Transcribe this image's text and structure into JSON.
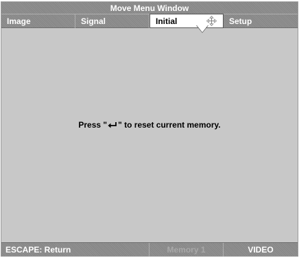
{
  "window": {
    "title": "Move Menu Window"
  },
  "tabs": [
    {
      "label": "Image",
      "active": false
    },
    {
      "label": "Signal",
      "active": false
    },
    {
      "label": "Initial",
      "active": true,
      "icon": "move-arrows-icon"
    },
    {
      "label": "Setup",
      "active": false
    }
  ],
  "message": {
    "prefix": "Press \"",
    "icon": "enter-return-icon",
    "suffix": "\" to reset current memory."
  },
  "status": {
    "escape": "ESCAPE: Return",
    "memory": "Memory 1",
    "source": "VIDEO"
  },
  "colors": {
    "bar": "#8c8c8c",
    "content": "#c8c8c8",
    "active_tab": "#ffffff",
    "bar_text": "#ffffff",
    "dim_text": "#a8a8a8"
  }
}
